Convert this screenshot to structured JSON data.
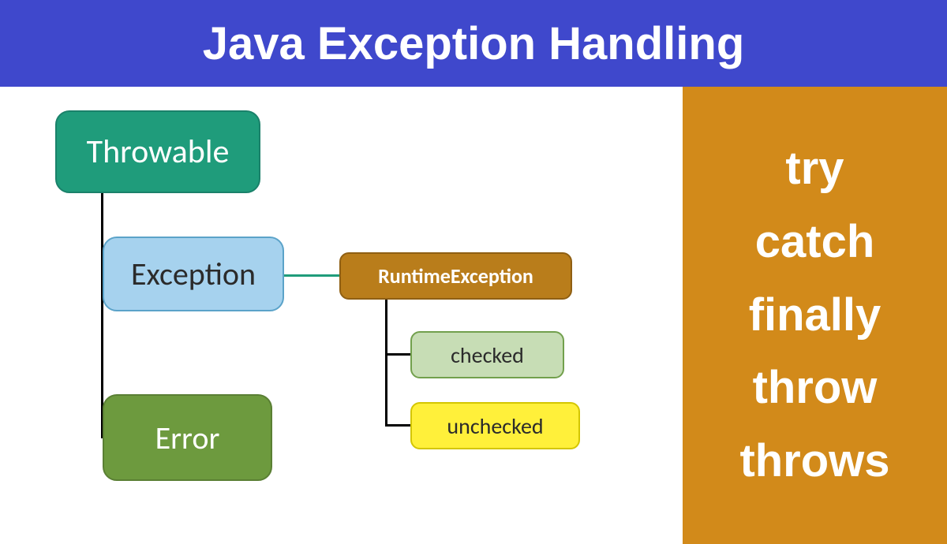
{
  "header": {
    "title": "Java Exception Handling"
  },
  "sidebar": {
    "keywords": [
      "try",
      "catch",
      "finally",
      "throw",
      "throws"
    ]
  },
  "diagram": {
    "nodes": {
      "throwable": "Throwable",
      "exception": "Exception",
      "error": "Error",
      "runtime": "RuntimeException",
      "checked": "checked",
      "unchecked": "unchecked"
    }
  }
}
